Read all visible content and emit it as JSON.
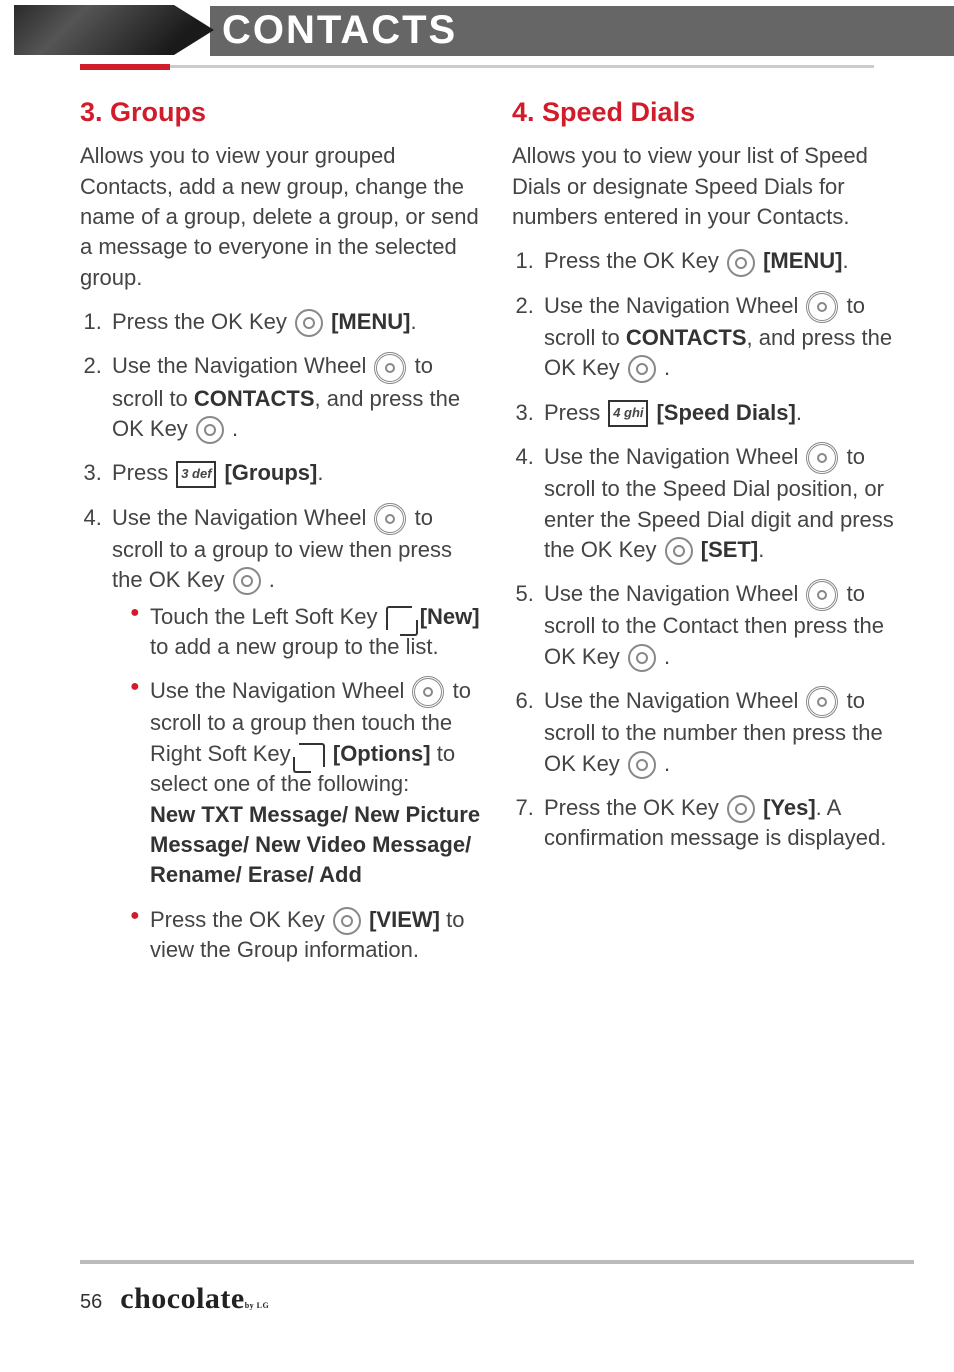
{
  "header": {
    "title": "CONTACTS"
  },
  "left": {
    "title": "3. Groups",
    "intro": "Allows you to view your grouped Contacts, add a new group, change the name of a group, delete a group, or send a message to everyone in the selected group.",
    "steps": {
      "s1": {
        "a": "Press the OK Key ",
        "b": " [MENU]",
        "c": "."
      },
      "s2": {
        "a": "Use the Navigation Wheel ",
        "b": " to scroll to ",
        "c": "CONTACTS",
        "d": ", and press the OK Key ",
        "e": " ."
      },
      "s3": {
        "a": "Press ",
        "key": "3 def",
        "b": " [Groups]",
        "c": "."
      },
      "s4": {
        "a": "Use the Navigation Wheel ",
        "b": " to scroll to a group to view then press the OK Key ",
        "c": " ."
      }
    },
    "bullets": {
      "b1": {
        "a": "Touch the Left Soft Key ",
        "b": " [New]",
        "c": " to add a new group to the list."
      },
      "b2": {
        "a": "Use the Navigation Wheel ",
        "b": " to scroll to a group then touch the Right Soft Key ",
        "c": " [Options]",
        "d": " to select one of the following:",
        "opts": "New TXT Message/ New Picture Message/ New Video Message/ Rename/ Erase/ Add"
      },
      "b3": {
        "a": "Press the OK Key ",
        "b": " [VIEW]",
        "c": " to view the Group information."
      }
    }
  },
  "right": {
    "title": "4. Speed Dials",
    "intro": "Allows you to view your list of Speed Dials or designate Speed Dials for numbers entered in your Contacts.",
    "steps": {
      "s1": {
        "a": "Press the OK Key ",
        "b": " [MENU]",
        "c": "."
      },
      "s2": {
        "a": "Use the Navigation Wheel ",
        "b": " to scroll to ",
        "c": "CONTACTS",
        "d": ", and press the OK Key ",
        "e": " ."
      },
      "s3": {
        "a": "Press ",
        "key": "4 ghi",
        "b": " [Speed Dials]",
        "c": "."
      },
      "s4": {
        "a": "Use the Navigation Wheel ",
        "b": " to scroll to the Speed Dial position, or enter the Speed Dial digit and press the OK Key ",
        "c": " [SET]",
        "d": "."
      },
      "s5": {
        "a": "Use the Navigation Wheel ",
        "b": " to scroll to the Contact then press the OK Key ",
        "c": " ."
      },
      "s6": {
        "a": "Use the Navigation Wheel ",
        "b": " to scroll to the number then press the OK Key ",
        "c": " ."
      },
      "s7": {
        "a": "Press the OK Key ",
        "b": " [Yes]",
        "c": ". A confirmation message is displayed."
      }
    }
  },
  "footer": {
    "page": "56",
    "brand": "chocolate",
    "brand_sub": "by LG"
  }
}
